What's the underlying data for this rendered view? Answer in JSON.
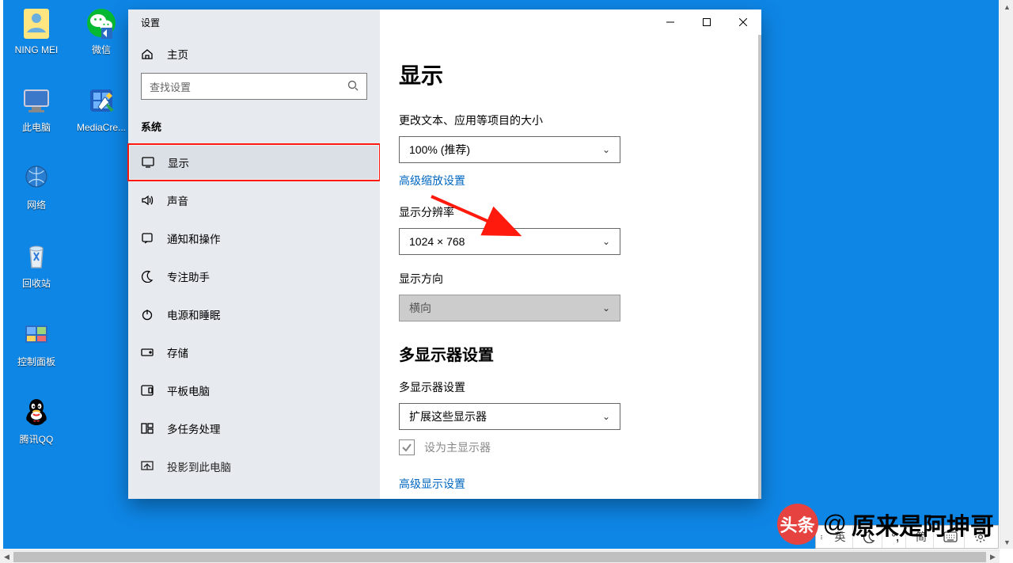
{
  "desktop_icons": [
    {
      "label": "NING MEI"
    },
    {
      "label": "微信"
    },
    {
      "label": "此电脑"
    },
    {
      "label": "MediaCre..."
    },
    {
      "label": "网络"
    },
    {
      "label": "回收站"
    },
    {
      "label": "控制面板"
    },
    {
      "label": "腾讯QQ"
    }
  ],
  "settings": {
    "title": "设置",
    "home": "主页",
    "search_placeholder": "查找设置",
    "section": "系统",
    "nav": [
      "显示",
      "声音",
      "通知和操作",
      "专注助手",
      "电源和睡眠",
      "存储",
      "平板电脑",
      "多任务处理",
      "投影到此电脑"
    ]
  },
  "display": {
    "page_title": "显示",
    "scale_label": "更改文本、应用等项目的大小",
    "scale_value": "100% (推荐)",
    "scale_link": "高级缩放设置",
    "res_label": "显示分辨率",
    "res_value": "1024 × 768",
    "orient_label": "显示方向",
    "orient_value": "横向",
    "multi_heading": "多显示器设置",
    "multi_label": "多显示器设置",
    "multi_value": "扩展这些显示器",
    "primary_label": "设为主显示器",
    "adv_link": "高级显示设置"
  },
  "ime": {
    "lang": "英",
    "mode": "简"
  },
  "watermark": {
    "brand": "头条",
    "prefix": "@",
    "name": "原来是阿坤哥"
  }
}
